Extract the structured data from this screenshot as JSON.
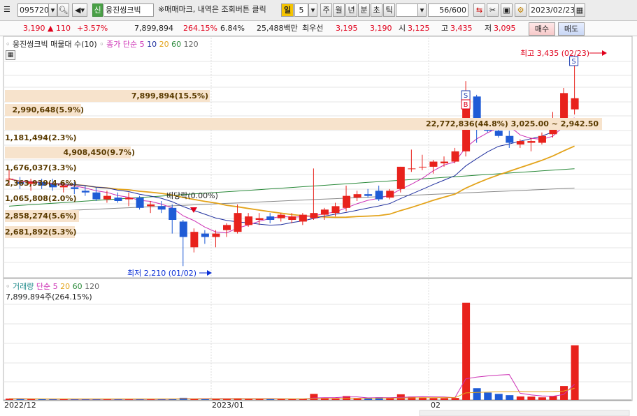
{
  "toolbar": {
    "code": "095720",
    "badge": "신",
    "name": "웅진씽크빅",
    "note": "※매매마크, 내역은 조회버튼 클릭",
    "period_label": "일",
    "period_value": "5",
    "units": [
      "주",
      "월",
      "년",
      "분",
      "초",
      "틱"
    ],
    "count": "56",
    "count_total": "/600",
    "date": "2023/02/23"
  },
  "quote": {
    "price": "3,190",
    "direction": "▲",
    "change": "110",
    "change_pct": "+3.57%",
    "volume": "7,899,894",
    "volume_ratio": "264.15%",
    "turnover": "6.84%",
    "amount": "25,488백만",
    "pref_label": "최우선",
    "ask": "3,195",
    "bid": "3,190",
    "open_label": "시",
    "open": "3,125",
    "high_label": "고",
    "high": "3,435",
    "low_label": "저",
    "low": "3,095",
    "buy_label": "매수",
    "sell_label": "매도"
  },
  "price_panel": {
    "title": "웅진씽크빅 매물대 수(10)",
    "ma_label": "종가 단순",
    "ma_periods": [
      "5",
      "10",
      "20",
      "60",
      "120"
    ],
    "ma_colors": [
      "#cc2fb4",
      "#1f2f9e",
      "#e3a31a",
      "#2a8a3a",
      "#666666"
    ],
    "high_note": "최고 3,435 (02/23)",
    "low_note": "최저 2,210 (01/02)",
    "dividend_note": "배당락(0.00%)",
    "volume_profile": [
      {
        "label": "7,899,894(15.5%)"
      },
      {
        "label": "2,990,648(5.9%)"
      },
      {
        "label": "22,772,836(44.8%) 3,025.00 ~ 2,942.50"
      },
      {
        "label": "1,181,494(2.3%)"
      },
      {
        "label": "4,908,450(9.7%)"
      },
      {
        "label": "1,676,037(3.3%)"
      },
      {
        "label": "2,363,939(4.6%)"
      },
      {
        "label": "1,065,808(2.0%)"
      },
      {
        "label": "2,858,274(5.6%)"
      },
      {
        "label": "2,681,892(5.3%)"
      }
    ]
  },
  "volume_panel": {
    "title": "거래량",
    "ma_label": "단순",
    "ma_periods": [
      "5",
      "20",
      "60",
      "120"
    ],
    "value_note": "7,899,894주(264.15%)"
  },
  "x_axis": [
    "2022/12",
    "2023/01",
    "02"
  ],
  "marks": {
    "sell": "S",
    "buy": "B"
  },
  "chart_data": {
    "type": "candlestick",
    "candles": [
      [
        2720,
        2770,
        2680,
        2720
      ],
      [
        2700,
        2730,
        2660,
        2690
      ],
      [
        2690,
        2720,
        2650,
        2700
      ],
      [
        2700,
        2720,
        2660,
        2680
      ],
      [
        2690,
        2720,
        2650,
        2670
      ],
      [
        2670,
        2700,
        2640,
        2680
      ],
      [
        2670,
        2700,
        2630,
        2660
      ],
      [
        2650,
        2680,
        2620,
        2640
      ],
      [
        2640,
        2670,
        2590,
        2600
      ],
      [
        2600,
        2650,
        2580,
        2620
      ],
      [
        2610,
        2640,
        2580,
        2590
      ],
      [
        2600,
        2640,
        2560,
        2610
      ],
      [
        2610,
        2620,
        2540,
        2550
      ],
      [
        2560,
        2590,
        2520,
        2570
      ],
      [
        2560,
        2590,
        2520,
        2540
      ],
      [
        2550,
        2570,
        2400,
        2480
      ],
      [
        2470,
        2480,
        2210,
        2380
      ],
      [
        2320,
        2430,
        2290,
        2410
      ],
      [
        2400,
        2420,
        2340,
        2380
      ],
      [
        2380,
        2420,
        2320,
        2400
      ],
      [
        2420,
        2460,
        2380,
        2450
      ],
      [
        2410,
        2570,
        2400,
        2520
      ],
      [
        2450,
        2520,
        2440,
        2500
      ],
      [
        2480,
        2520,
        2450,
        2490
      ],
      [
        2500,
        2520,
        2460,
        2480
      ],
      [
        2490,
        2520,
        2470,
        2510
      ],
      [
        2480,
        2520,
        2460,
        2500
      ],
      [
        2470,
        2520,
        2450,
        2510
      ],
      [
        2490,
        2780,
        2480,
        2520
      ],
      [
        2510,
        2550,
        2480,
        2540
      ],
      [
        2520,
        2580,
        2500,
        2560
      ],
      [
        2550,
        2680,
        2530,
        2620
      ],
      [
        2610,
        2650,
        2590,
        2630
      ],
      [
        2630,
        2660,
        2610,
        2620
      ],
      [
        2650,
        2680,
        2590,
        2600
      ],
      [
        2610,
        2660,
        2600,
        2650
      ],
      [
        2660,
        2790,
        2640,
        2790
      ],
      [
        2780,
        2890,
        2760,
        2780
      ],
      [
        2790,
        2860,
        2770,
        2790
      ],
      [
        2790,
        2830,
        2750,
        2820
      ],
      [
        2810,
        2850,
        2790,
        2820
      ],
      [
        2820,
        2900,
        2810,
        2880
      ],
      [
        2880,
        3290,
        2850,
        3200
      ],
      [
        3200,
        3210,
        2930,
        3040
      ],
      [
        3030,
        3050,
        2990,
        3000
      ],
      [
        3000,
        3030,
        2960,
        2970
      ],
      [
        2970,
        3000,
        2900,
        2930
      ],
      [
        2920,
        2950,
        2900,
        2940
      ],
      [
        2930,
        2960,
        2880,
        2940
      ],
      [
        2930,
        2990,
        2920,
        2970
      ],
      [
        2980,
        3110,
        2960,
        3060
      ],
      [
        3060,
        3250,
        3050,
        3220
      ],
      [
        3125,
        3435,
        3095,
        3190
      ]
    ],
    "volumes": [
      150000,
      120000,
      110000,
      100000,
      100000,
      120000,
      110000,
      100000,
      90000,
      120000,
      110000,
      100000,
      120000,
      90000,
      100000,
      160000,
      250000,
      140000,
      120000,
      110000,
      180000,
      210000,
      150000,
      130000,
      110000,
      100000,
      130000,
      110000,
      700000,
      230000,
      200000,
      450000,
      180000,
      160000,
      300000,
      210000,
      650000,
      380000,
      300000,
      210000,
      200000,
      230000,
      11200000,
      1350000,
      850000,
      700000,
      550000,
      400000,
      380000,
      300000,
      450000,
      1600000,
      6300000
    ],
    "ylim": [
      2150,
      3470
    ],
    "volume_ylim": [
      0,
      11500000
    ]
  }
}
